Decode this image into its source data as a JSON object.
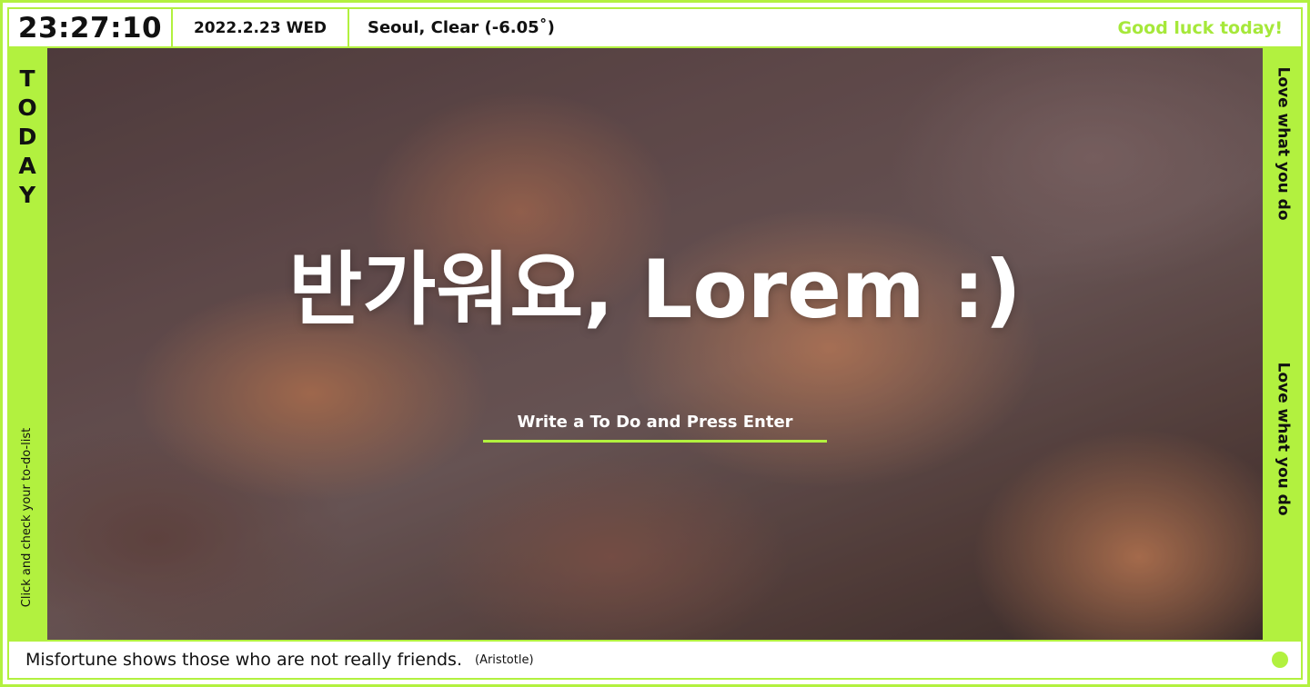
{
  "header": {
    "clock": "23:27:10",
    "date": "2022.2.23 WED",
    "weather": "Seoul, Clear (-6.05˚)",
    "greeting": "Good luck today!"
  },
  "left_panel": {
    "today_letters": [
      "T",
      "O",
      "D",
      "A",
      "Y"
    ],
    "hint": "Click and check your to-do-list"
  },
  "right_panel": {
    "slogan_top": "Love what you do",
    "slogan_bottom": "Love what you do"
  },
  "main": {
    "headline": "반가워요, Lorem :)",
    "todo_placeholder": "Write a To Do and Press Enter"
  },
  "footer": {
    "quote": "Misfortune shows those who are not really friends.",
    "author": "(Aristotle)"
  },
  "colors": {
    "accent": "#b2f13f",
    "greeting": "#a6e83a",
    "text": "#111111",
    "headline": "#ffffff"
  }
}
